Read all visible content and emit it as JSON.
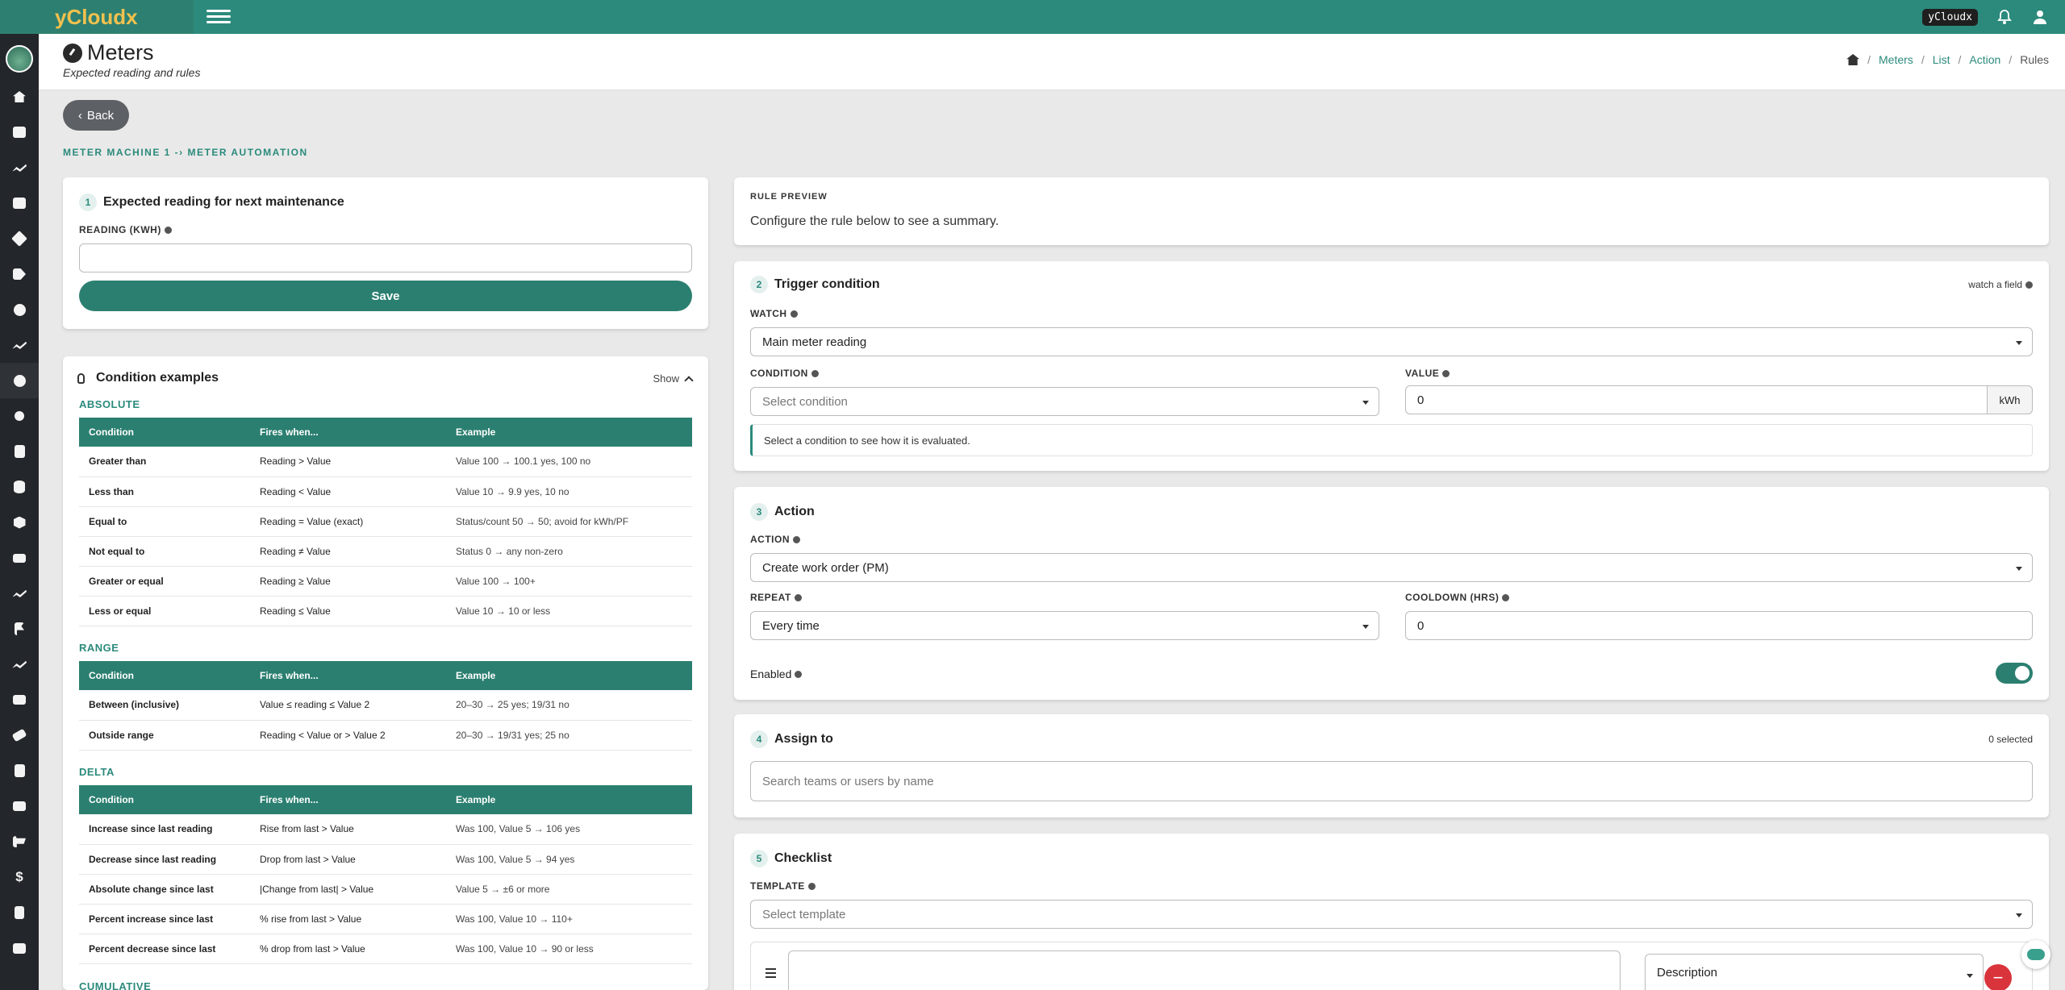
{
  "app": {
    "brand": "yCloudx",
    "user_chip": "yCloudx"
  },
  "header": {
    "title": "Meters",
    "subtitle": "Expected reading and rules",
    "breadcrumb": [
      "Meters",
      "List",
      "Action",
      "Rules"
    ]
  },
  "back_label": "Back",
  "context_title": "METER MACHINE 1 -› METER AUTOMATION",
  "expected": {
    "step": "1",
    "title": "Expected reading for next maintenance",
    "reading_label": "READING (KWH)",
    "reading_value": "",
    "save_label": "Save"
  },
  "examples": {
    "title": "Condition examples",
    "toggle_label": "Show",
    "headers": [
      "Condition",
      "Fires when...",
      "Example"
    ],
    "sections": [
      {
        "name": "ABSOLUTE",
        "rows": [
          [
            "Greater than",
            "Reading > Value",
            "Value 100 → 100.1 yes, 100 no"
          ],
          [
            "Less than",
            "Reading < Value",
            "Value 10 → 9.9 yes, 10 no"
          ],
          [
            "Equal to",
            "Reading = Value (exact)",
            "Status/count 50 → 50; avoid for kWh/PF"
          ],
          [
            "Not equal to",
            "Reading ≠ Value",
            "Status 0 → any non-zero"
          ],
          [
            "Greater or equal",
            "Reading ≥ Value",
            "Value 100 → 100+"
          ],
          [
            "Less or equal",
            "Reading ≤ Value",
            "Value 10 → 10 or less"
          ]
        ]
      },
      {
        "name": "RANGE",
        "rows": [
          [
            "Between (inclusive)",
            "Value ≤ reading ≤ Value 2",
            "20–30 → 25 yes; 19/31 no"
          ],
          [
            "Outside range",
            "Reading < Value or > Value 2",
            "20–30 → 19/31 yes; 25 no"
          ]
        ]
      },
      {
        "name": "DELTA",
        "rows": [
          [
            "Increase since last reading",
            "Rise from last > Value",
            "Was 100, Value 5 → 106 yes"
          ],
          [
            "Decrease since last reading",
            "Drop from last > Value",
            "Was 100, Value 5 → 94 yes"
          ],
          [
            "Absolute change since last",
            "|Change from last| > Value",
            "Value 5 → ±6 or more"
          ],
          [
            "Percent increase since last",
            "% rise from last > Value",
            "Was 100, Value 10 → 110+"
          ],
          [
            "Percent decrease since last",
            "% drop from last > Value",
            "Was 100, Value 10 → 90 or less"
          ]
        ]
      },
      {
        "name": "CUMULATIVE",
        "rows": []
      }
    ]
  },
  "preview": {
    "label": "RULE PREVIEW",
    "text": "Configure the rule below to see a summary."
  },
  "trigger": {
    "step": "2",
    "title": "Trigger condition",
    "aside": "watch a field",
    "watch_label": "WATCH",
    "watch_value": "Main meter reading",
    "condition_label": "CONDITION",
    "condition_placeholder": "Select condition",
    "value_label": "VALUE",
    "value_value": "0",
    "unit": "kWh",
    "hint": "Select a condition to see how it is evaluated."
  },
  "action": {
    "step": "3",
    "title": "Action",
    "action_label": "ACTION",
    "action_value": "Create work order (PM)",
    "repeat_label": "REPEAT",
    "repeat_value": "Every time",
    "cooldown_label": "COOLDOWN (HRS)",
    "cooldown_value": "0",
    "enabled_label": "Enabled",
    "enabled": true
  },
  "assign": {
    "step": "4",
    "title": "Assign to",
    "count": "0 selected",
    "placeholder": "Search teams or users by name"
  },
  "checklist": {
    "step": "5",
    "title": "Checklist",
    "template_label": "TEMPLATE",
    "template_placeholder": "Select template",
    "item_type": "Description"
  },
  "colors": {
    "accent": "#2b8a7c",
    "topbar": "#2b8a7c",
    "brand_text": "#f2c14e",
    "danger": "#d9333c"
  }
}
